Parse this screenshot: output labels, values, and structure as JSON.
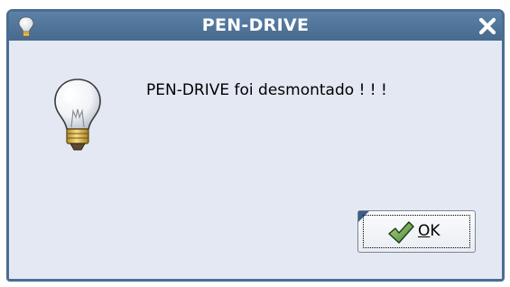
{
  "dialog": {
    "title": "PEN-DRIVE",
    "message": "PEN-DRIVE foi desmontado ! ! !",
    "icon": "lightbulb-icon",
    "close_icon": "close-icon",
    "ok_button": {
      "label": "OK",
      "icon": "checkmark-icon",
      "mnemonic": "O"
    }
  },
  "colors": {
    "titlebar": "#4f7399",
    "background": "#e3e8f3",
    "title_text": "#ffffff",
    "focus_corner": "#3d5f86"
  }
}
